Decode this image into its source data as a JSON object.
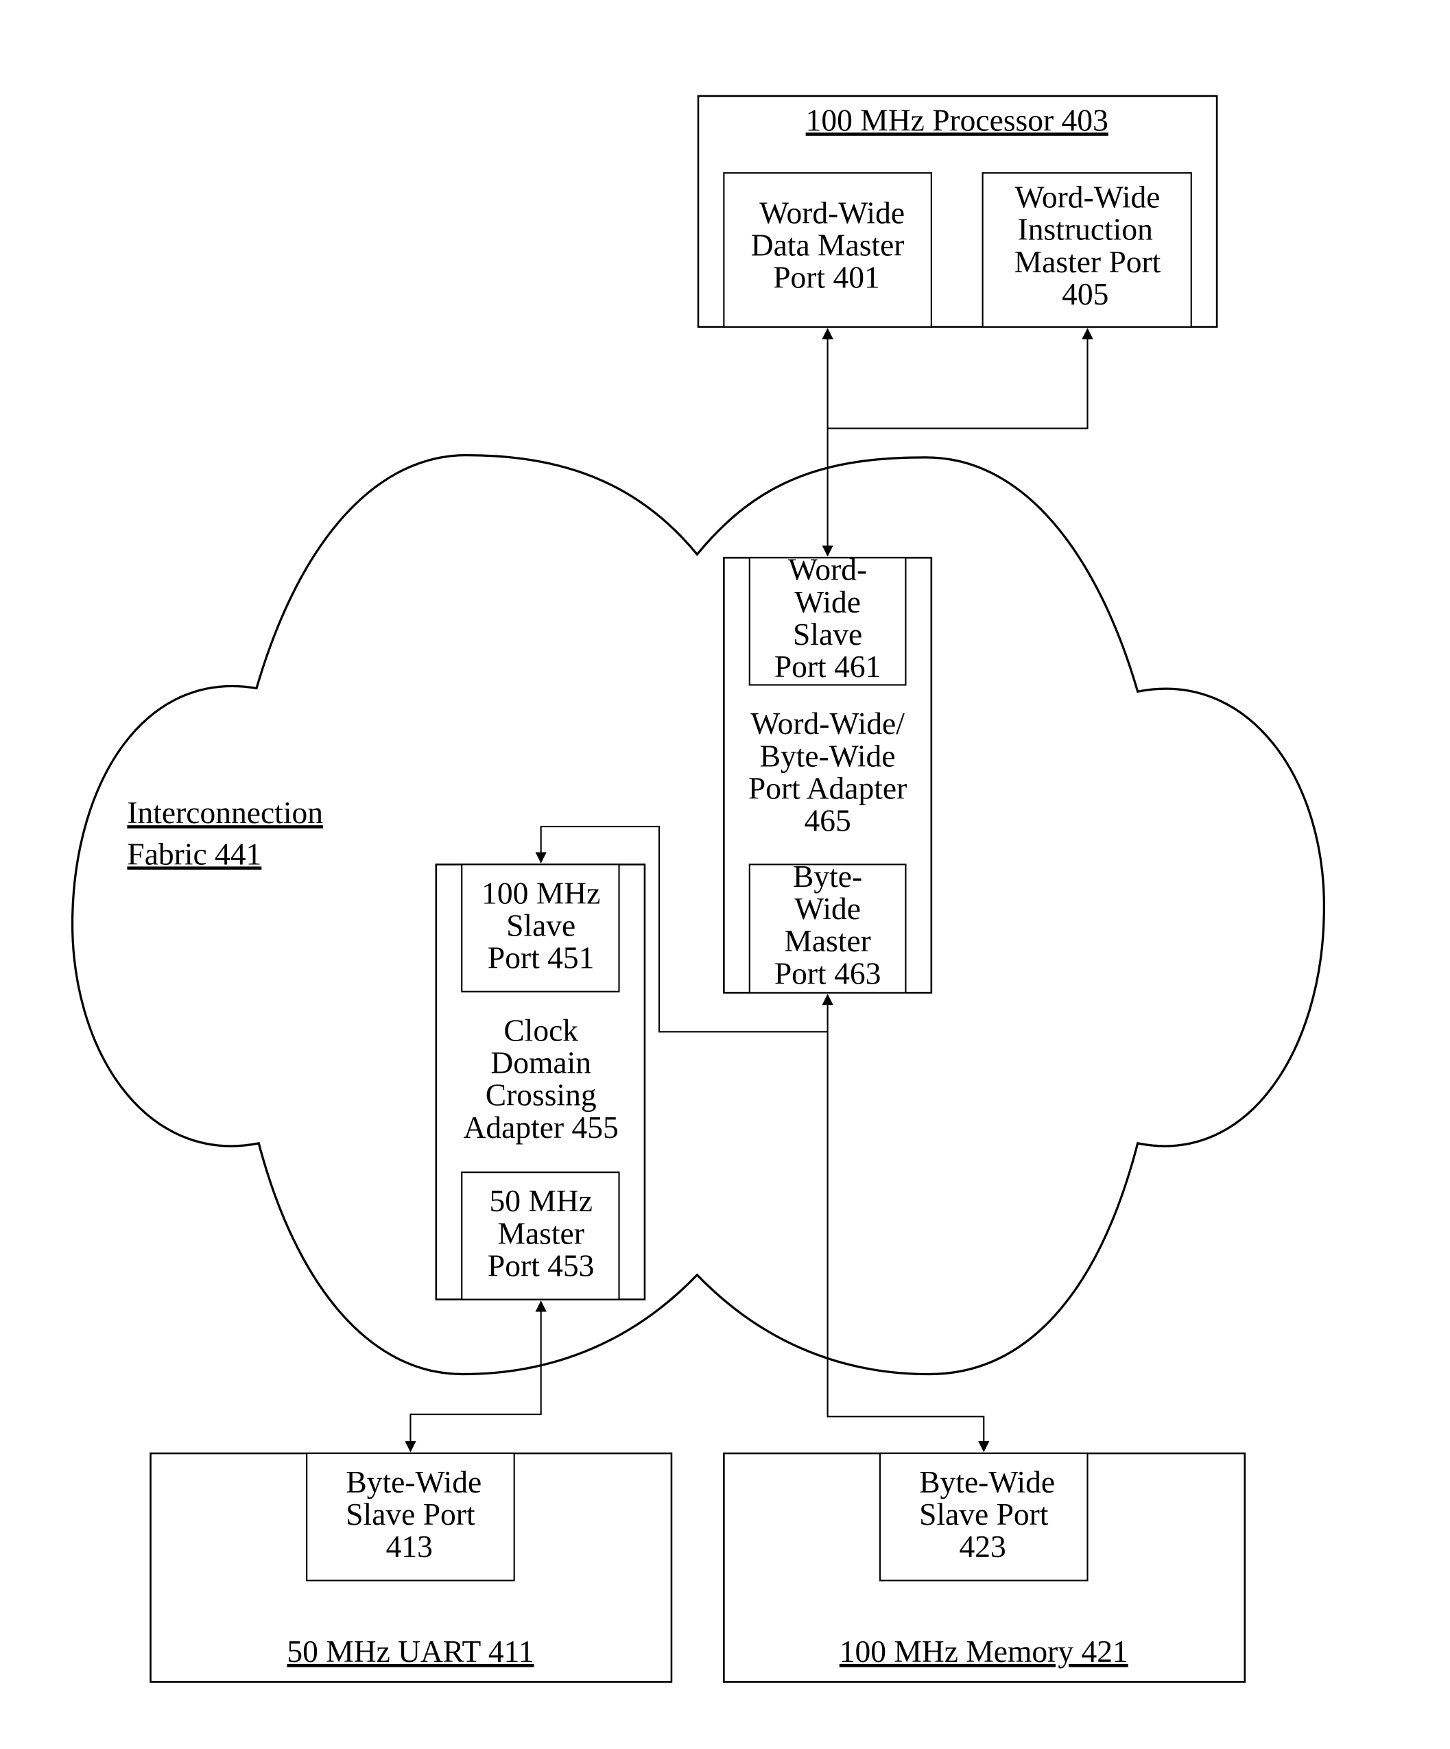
{
  "figure": {
    "fabric": {
      "label_line1": "Interconnection",
      "label_line2": "Fabric 441"
    },
    "processor": {
      "title": "100 MHz Processor 403",
      "data_port": [
        "Word-Wide",
        "Data Master",
        "Port 401"
      ],
      "instruction_port": [
        "Word-Wide",
        "Instruction",
        "Master Port",
        "405"
      ]
    },
    "width_adapter": {
      "label": [
        "Word-Wide/",
        "Byte-Wide",
        "Port Adapter",
        "465"
      ],
      "slave_port": [
        "Word-",
        "Wide",
        "Slave",
        "Port 461"
      ],
      "master_port": [
        "Byte-",
        "Wide",
        "Master",
        "Port 463"
      ]
    },
    "clock_adapter": {
      "label": [
        "Clock",
        "Domain",
        "Crossing",
        "Adapter 455"
      ],
      "slave_port": [
        "100 MHz",
        "Slave",
        "Port 451"
      ],
      "master_port": [
        "50 MHz",
        "Master",
        "Port 453"
      ]
    },
    "uart": {
      "title": "50 MHz UART 411",
      "slave_port": [
        "Byte-Wide",
        "Slave Port",
        "413"
      ]
    },
    "memory": {
      "title": "100 MHz Memory 421",
      "slave_port": [
        "Byte-Wide",
        "Slave Port",
        "423"
      ]
    }
  }
}
